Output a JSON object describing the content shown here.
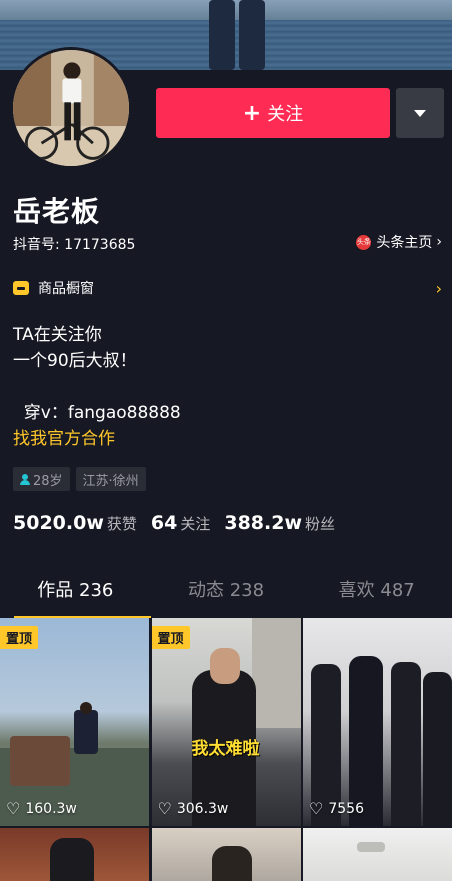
{
  "profile": {
    "name": "岳老板",
    "douyin_id": "抖音号: 17173685",
    "toutiao_label": "头条主页",
    "toutiao_badge": "头条"
  },
  "actions": {
    "follow_label": "关注",
    "follow_plus": "+"
  },
  "shop": {
    "label": "商品橱窗"
  },
  "bio": {
    "lines": [
      "TA在关注你",
      "一个90后大叔！",
      "",
      "  穿v：fangao88888"
    ],
    "link": "找我官方合作"
  },
  "tags": {
    "age": "28岁",
    "location": "江苏·徐州"
  },
  "stats": [
    {
      "num": "5020.0w",
      "label": "获赞"
    },
    {
      "num": "64",
      "label": "关注"
    },
    {
      "num": "388.2w",
      "label": "粉丝"
    }
  ],
  "tabs": [
    {
      "label": "作品 236"
    },
    {
      "label": "动态 238"
    },
    {
      "label": "喜欢 487"
    }
  ],
  "videos": [
    {
      "pinned": "置顶",
      "likes": "160.3w",
      "overlay": ""
    },
    {
      "pinned": "置顶",
      "likes": "306.3w",
      "overlay": "我太难啦"
    },
    {
      "pinned": "",
      "likes": "7556",
      "overlay": ""
    }
  ],
  "colors": {
    "accent": "#fe2c55",
    "gold": "#ffc72a",
    "bg": "#161823"
  }
}
